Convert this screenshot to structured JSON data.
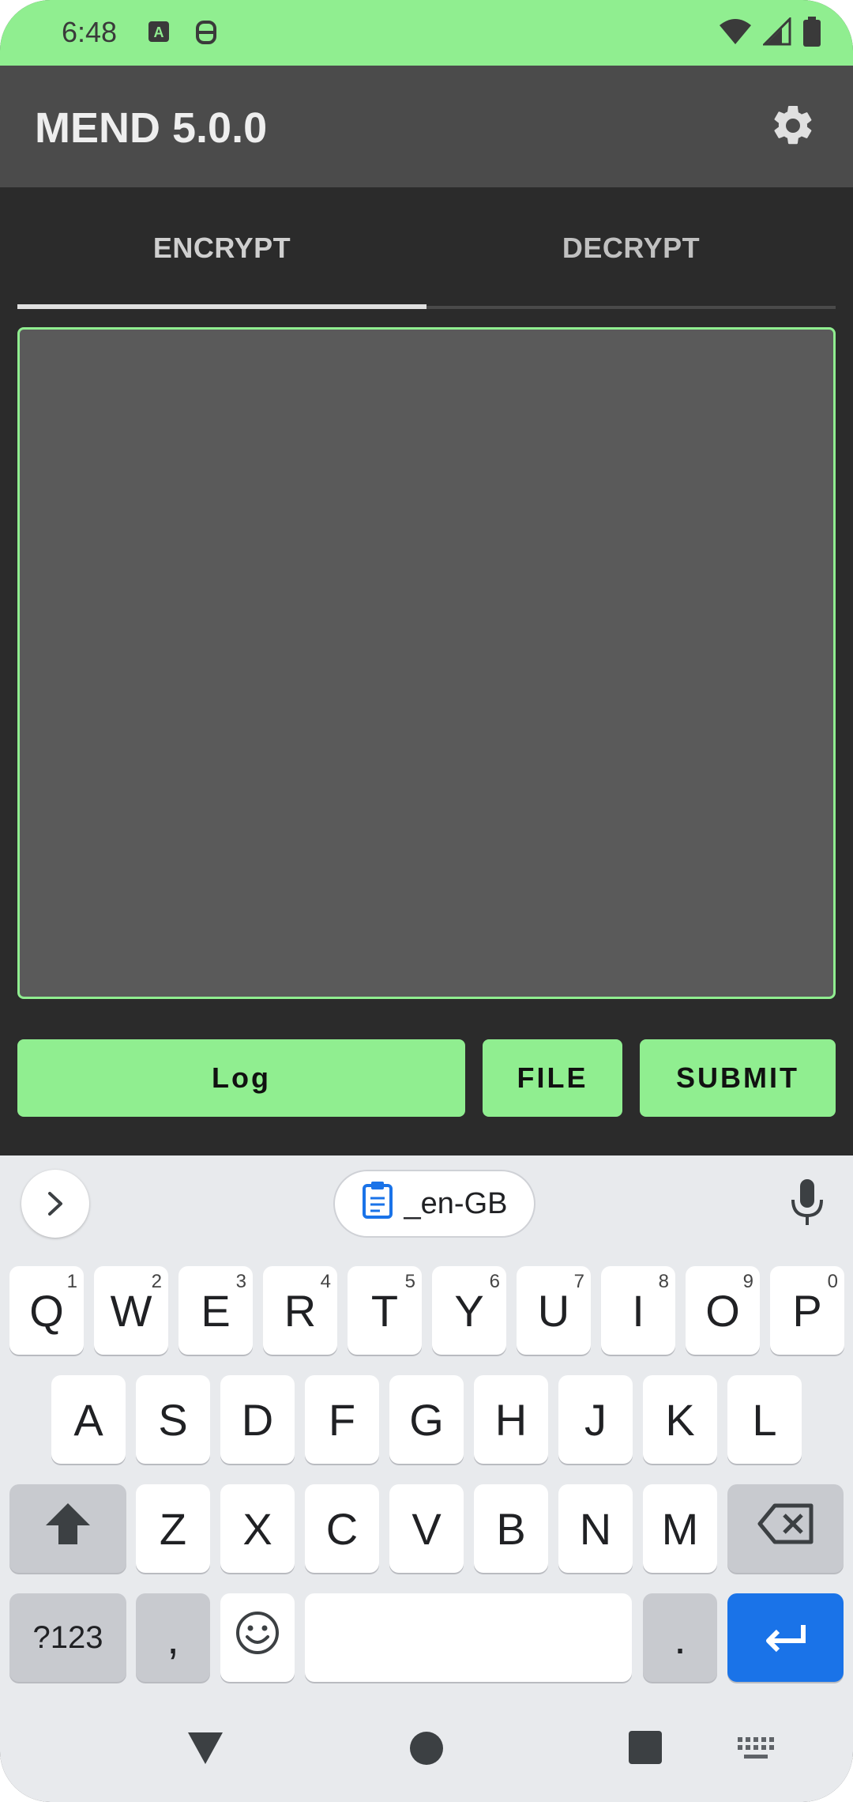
{
  "status": {
    "time": "6:48",
    "icons": [
      "a-keyboard-icon",
      "face-icon",
      "wifi-icon",
      "signal-icon",
      "battery-icon"
    ]
  },
  "app": {
    "title": "MEND 5.0.0",
    "settings_icon": "gear-icon"
  },
  "tabs": [
    {
      "label": "ENCRYPT",
      "selected": true
    },
    {
      "label": "DECRYPT",
      "selected": false
    }
  ],
  "input": {
    "value": ""
  },
  "buttons": {
    "log": "Log",
    "file": "FILE",
    "submit": "SUBMIT"
  },
  "keyboard": {
    "clipboard_label": "_en-GB",
    "row1": [
      {
        "k": "Q",
        "h": "1"
      },
      {
        "k": "W",
        "h": "2"
      },
      {
        "k": "E",
        "h": "3"
      },
      {
        "k": "R",
        "h": "4"
      },
      {
        "k": "T",
        "h": "5"
      },
      {
        "k": "Y",
        "h": "6"
      },
      {
        "k": "U",
        "h": "7"
      },
      {
        "k": "I",
        "h": "8"
      },
      {
        "k": "O",
        "h": "9"
      },
      {
        "k": "P",
        "h": "0"
      }
    ],
    "row2": [
      "A",
      "S",
      "D",
      "F",
      "G",
      "H",
      "J",
      "K",
      "L"
    ],
    "row3": [
      "Z",
      "X",
      "C",
      "V",
      "B",
      "N",
      "M"
    ],
    "symbols": "?123",
    "comma": ",",
    "period": "."
  },
  "colors": {
    "accent": "#90ee90",
    "appbar": "#4b4b4b",
    "background": "#2b2b2b",
    "input_bg": "#5a5a5a",
    "enter_key": "#1a73e8"
  }
}
